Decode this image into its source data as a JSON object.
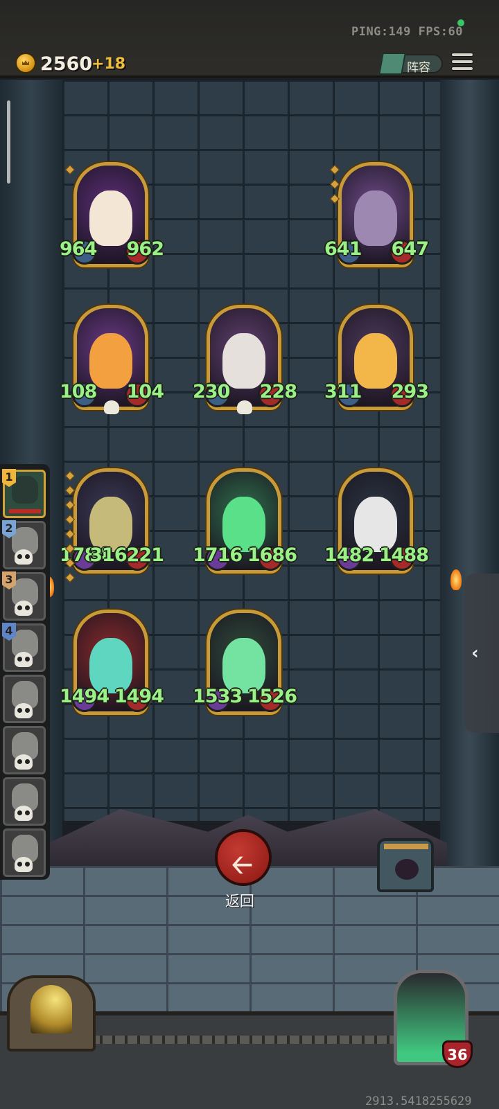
{
  "top_bar": {
    "status": "PING:149  FPS:60",
    "gold": "2560",
    "gold_gain": "+18",
    "lineup_label": "阵容"
  },
  "queue": [
    {
      "badge": "1",
      "active": true
    },
    {
      "badge": "2"
    },
    {
      "badge": "3"
    },
    {
      "badge": "4"
    },
    {
      "badge": ""
    },
    {
      "badge": ""
    },
    {
      "badge": ""
    },
    {
      "badge": ""
    }
  ],
  "cards": [
    {
      "name": "fire-horse",
      "atk": "964",
      "hp": "962",
      "stars": 1,
      "skull": false
    },
    {
      "name": "octopus-pirate",
      "atk": "641",
      "hp": "647",
      "stars": 3,
      "skull": false
    },
    {
      "name": "pelican",
      "atk": "108",
      "hp": "104",
      "stars": 0,
      "skull": true
    },
    {
      "name": "masked-rat",
      "atk": "230",
      "hp": "228",
      "stars": 0,
      "skull": true
    },
    {
      "name": "hamster",
      "atk": "311",
      "hp": "293",
      "stars": 0,
      "skull": false
    },
    {
      "name": "horned-reaper",
      "atk": "1784",
      "hp": "316221",
      "stars": 8,
      "skull": false
    },
    {
      "name": "green-ghost",
      "atk": "1716",
      "hp": "1686",
      "stars": 0,
      "skull": false
    },
    {
      "name": "skeleton-reaper",
      "atk": "1482",
      "hp": "1488",
      "stars": 0,
      "skull": false
    },
    {
      "name": "spectral-giant",
      "atk": "1494",
      "hp": "1494",
      "stars": 0,
      "skull": false
    },
    {
      "name": "cursed-sword",
      "atk": "1533",
      "hp": "1526",
      "stars": 0,
      "skull": false
    }
  ],
  "back_label": "返回",
  "hero_level": "36",
  "coordinate_readout": "2913.5418255629",
  "colors": {
    "stat_text": "#9bf087",
    "frame_gold": "#c99a38",
    "back_button": "#c43a32"
  }
}
